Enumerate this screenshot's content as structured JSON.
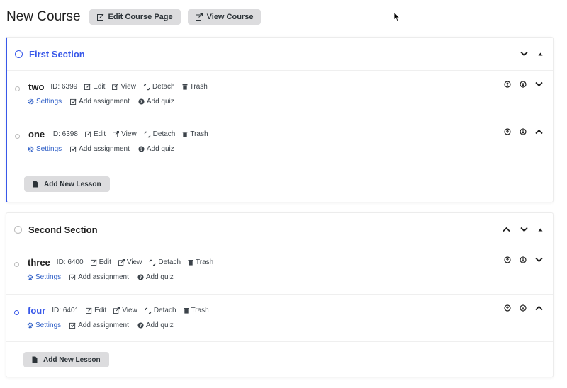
{
  "header": {
    "title": "New Course",
    "edit_page_label": "Edit Course Page",
    "view_course_label": "View Course"
  },
  "common": {
    "edit": "Edit",
    "view": "View",
    "detach": "Detach",
    "trash": "Trash",
    "settings": "Settings",
    "add_assignment": "Add assignment",
    "add_quiz": "Add quiz",
    "add_lesson": "Add New Lesson"
  },
  "colors": {
    "accent": "#3858e9",
    "link": "#2f5fc7",
    "button_bg": "#dcdcde"
  },
  "sections": [
    {
      "title": "First Section",
      "lessons": [
        {
          "name": "two",
          "id": "ID: 6399"
        },
        {
          "name": "one",
          "id": "ID: 6398"
        }
      ]
    },
    {
      "title": "Second Section",
      "lessons": [
        {
          "name": "three",
          "id": "ID: 6400"
        },
        {
          "name": "four",
          "id": "ID: 6401"
        }
      ]
    }
  ]
}
